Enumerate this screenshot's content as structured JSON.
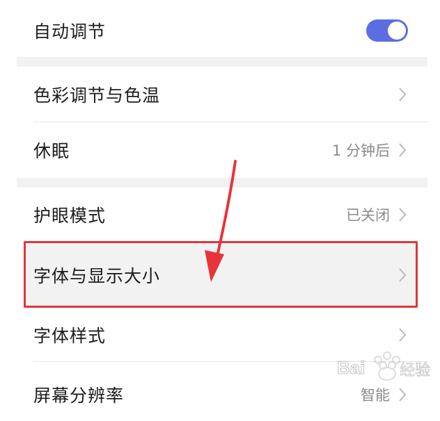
{
  "settings": {
    "auto_adjust": {
      "label": "自动调节",
      "enabled": true
    },
    "color_temp": {
      "label": "色彩调节与色温"
    },
    "sleep": {
      "label": "休眠",
      "value": "1 分钟后"
    },
    "eye_care": {
      "label": "护眼模式",
      "value": "已关闭"
    },
    "font_display_size": {
      "label": "字体与显示大小"
    },
    "font_style": {
      "label": "字体样式"
    },
    "resolution": {
      "label": "屏幕分辨率",
      "value": "智能"
    }
  },
  "colors": {
    "toggle_on": "#5b6ee1",
    "highlight": "#e0353b"
  },
  "watermark_text": "Bai 经验"
}
